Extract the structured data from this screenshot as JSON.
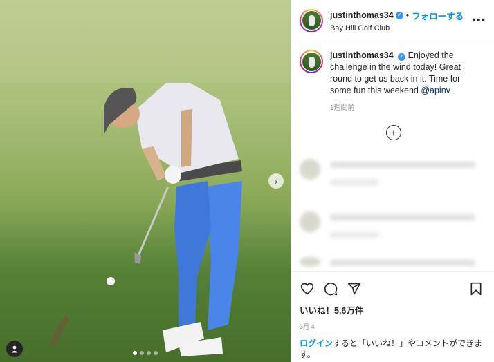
{
  "post": {
    "username": "justinthomas34",
    "verified": true,
    "separator": "•",
    "follow_label": "フォローする",
    "location": "Bay Hill Golf Club",
    "more_icon": "more-horizontal-icon"
  },
  "caption": {
    "username": "justinthomas34",
    "text": "Enjoyed the challenge in the wind today! Great round to get us back in it. Time for some fun this weekend ",
    "mention": "@apinv",
    "time": "1週間前"
  },
  "media": {
    "carousel_dots": 4,
    "active_dot": 1,
    "next_icon": "chevron-right-icon",
    "tagged_icon": "user-tag-icon",
    "colors": {
      "grass": "#8aa958",
      "shirt": "#e8e8ee",
      "pants": "#4a86e8",
      "cap": "#555555"
    }
  },
  "comments": {
    "load_more_icon": "plus-circle-icon",
    "blurred_count": 3
  },
  "actions": {
    "like_icon": "heart-icon",
    "comment_icon": "comment-icon",
    "share_icon": "send-icon",
    "save_icon": "bookmark-icon",
    "likes_label": "いいね！5.6万件",
    "date": "3月 4"
  },
  "login": {
    "link": "ログイン",
    "text": "すると「いいね！」やコメントができます。"
  },
  "theme": {
    "accent": "#0095f6",
    "text": "#262626",
    "muted": "#8e8e8e",
    "border": "#efefef"
  }
}
